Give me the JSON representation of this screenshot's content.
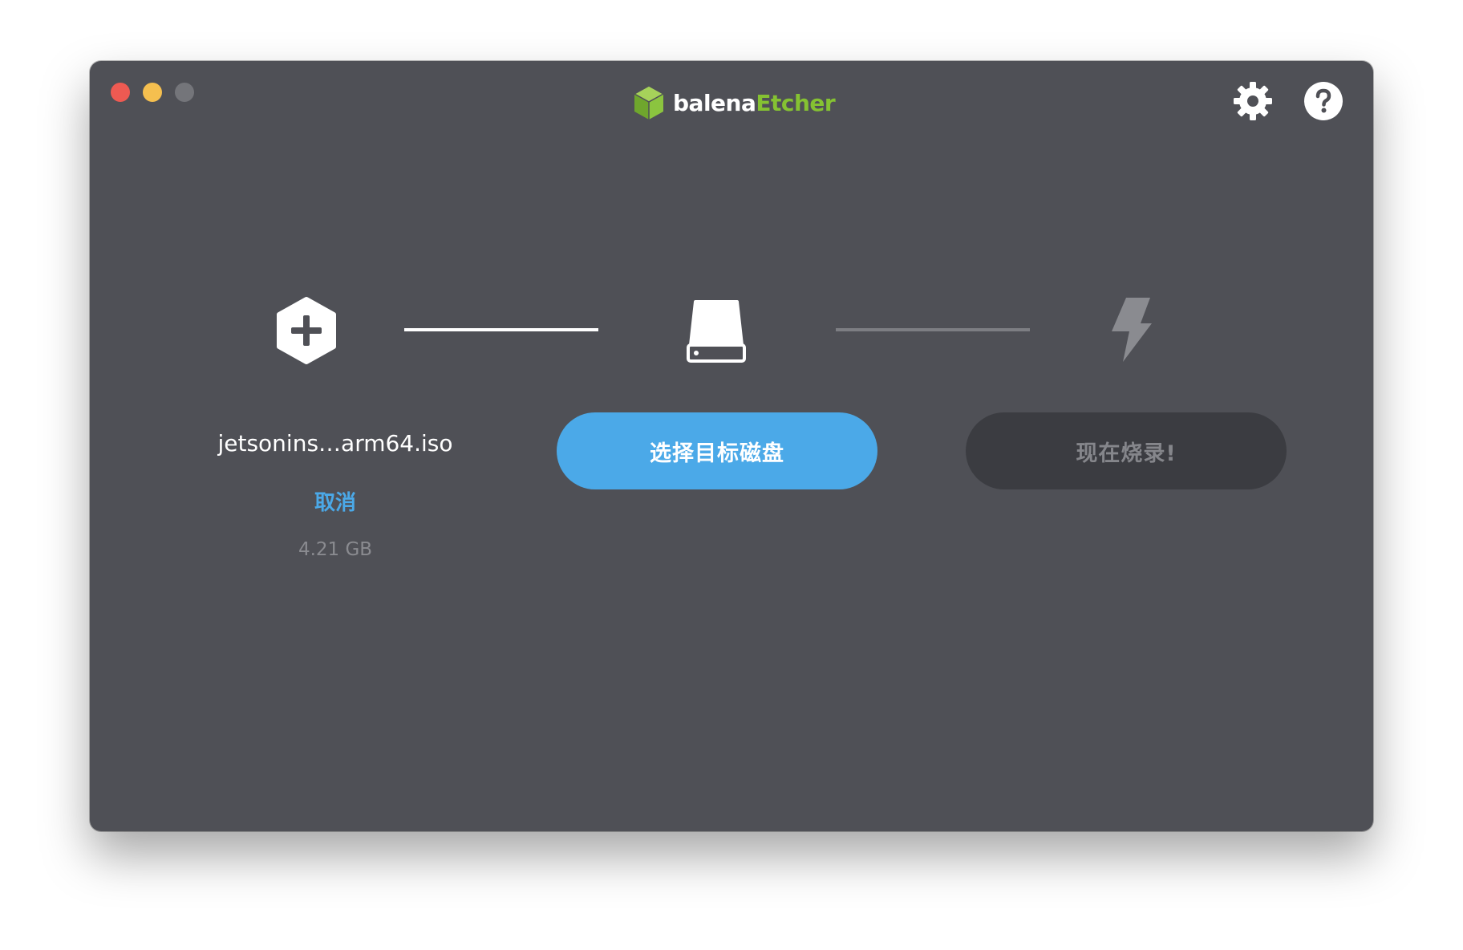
{
  "app": {
    "brand_part1": "balena",
    "brand_part2": "Etcher"
  },
  "colors": {
    "window_bg": "#4f5056",
    "accent_blue": "#4ba9e8",
    "brand_green": "#85c232",
    "disabled_button_bg": "#3b3c41"
  },
  "icons": {
    "settings": "gear-icon",
    "help": "help-icon",
    "image": "hexagon-plus-icon",
    "drive": "drive-icon",
    "flash": "lightning-bolt-icon"
  },
  "source": {
    "file_name": "jetsonins…arm64.iso",
    "cancel_label": "取消",
    "size": "4.21 GB"
  },
  "target": {
    "select_label": "选择目标磁盘"
  },
  "flash": {
    "label": "现在烧录!"
  }
}
